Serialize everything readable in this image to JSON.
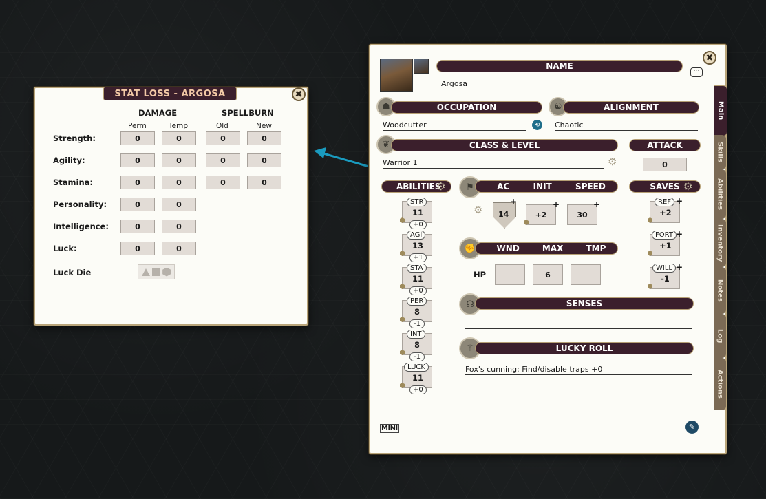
{
  "stat_loss": {
    "title": "STAT LOSS - ARGOSA",
    "close": "✖",
    "group_damage": "DAMAGE",
    "group_spellburn": "SPELLBURN",
    "col_perm": "Perm",
    "col_temp": "Temp",
    "col_old": "Old",
    "col_new": "New",
    "rows": [
      {
        "label": "Strength:",
        "perm": "0",
        "temp": "0",
        "old": "0",
        "new": "0"
      },
      {
        "label": "Agility:",
        "perm": "0",
        "temp": "0",
        "old": "0",
        "new": "0"
      },
      {
        "label": "Stamina:",
        "perm": "0",
        "temp": "0",
        "old": "0",
        "new": "0"
      },
      {
        "label": "Personality:",
        "perm": "0",
        "temp": "0"
      },
      {
        "label": "Intelligence:",
        "perm": "0",
        "temp": "0"
      },
      {
        "label": "Luck:",
        "perm": "0",
        "temp": "0"
      }
    ],
    "luck_die_label": "Luck Die"
  },
  "sheet": {
    "close": "✖",
    "name_header": "NAME",
    "name_value": "Argosa",
    "occupation_header": "OCCUPATION",
    "occupation_value": "Woodcutter",
    "alignment_header": "ALIGNMENT",
    "alignment_value": "Chaotic",
    "class_header": "CLASS & LEVEL",
    "class_value": "Warrior 1",
    "attack_header": "ATTACK",
    "attack_value": "0",
    "abilities_header": "ABILITIES",
    "abilities": [
      {
        "abbr": "STR",
        "score": "11",
        "mod": "+0"
      },
      {
        "abbr": "AGI",
        "score": "13",
        "mod": "+1"
      },
      {
        "abbr": "STA",
        "score": "11",
        "mod": "+0"
      },
      {
        "abbr": "PER",
        "score": "8",
        "mod": "-1"
      },
      {
        "abbr": "INT",
        "score": "8",
        "mod": "-1"
      },
      {
        "abbr": "LUCK",
        "score": "11",
        "mod": "+0"
      }
    ],
    "combat_ac": "AC",
    "combat_init": "INIT",
    "combat_speed": "SPEED",
    "ac_value": "14",
    "init_value": "+2",
    "speed_value": "30",
    "saves_header": "SAVES",
    "saves": [
      {
        "abbr": "REF",
        "value": "+2"
      },
      {
        "abbr": "FORT",
        "value": "+1"
      },
      {
        "abbr": "WILL",
        "value": "-1"
      }
    ],
    "hp_wnd": "WND",
    "hp_max": "MAX",
    "hp_tmp": "TMP",
    "hp_label": "HP",
    "hp_wnd_value": "",
    "hp_max_value": "6",
    "hp_tmp_value": "",
    "senses_header": "SENSES",
    "senses_value": "",
    "lucky_roll_header": "LUCKY ROLL",
    "lucky_roll_value": "Fox's cunning: Find/disable traps +0",
    "mini_label": "MINI",
    "tabs": [
      "Main",
      "Skills",
      "Abilities",
      "Inventory",
      "Notes",
      "Log",
      "Actions"
    ]
  },
  "colors": {
    "header_bar": "#3b1f2c",
    "highlight_ring": "#1a9bbf",
    "panel_bg": "#fcfcf7"
  }
}
